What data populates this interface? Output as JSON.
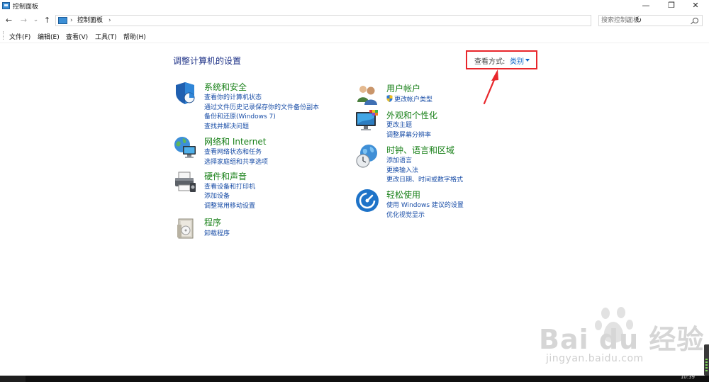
{
  "window": {
    "title": "控制面板",
    "controls": {
      "minimize": "—",
      "restore": "❐",
      "close": "✕"
    }
  },
  "nav": {
    "back": "←",
    "forward": "→",
    "recent": "⌄",
    "up": "↑",
    "refresh": "↻",
    "dropdown": "⌄"
  },
  "address": {
    "separator": "›",
    "path": "控制面板",
    "trailing_separator": "›"
  },
  "search": {
    "placeholder": "搜索控制面板",
    "value": ""
  },
  "menu": [
    "文件(F)",
    "编辑(E)",
    "查看(V)",
    "工具(T)",
    "帮助(H)"
  ],
  "main": {
    "title": "调整计算机的设置",
    "view_by": {
      "label": "查看方式:",
      "value": "类别"
    }
  },
  "categories_left": [
    {
      "title": "系统和安全",
      "icon": "shield-icon",
      "links": [
        "查看你的计算机状态",
        "通过文件历史记录保存你的文件备份副本",
        "备份和还原(Windows 7)",
        "查找并解决问题"
      ]
    },
    {
      "title": "网络和 Internet",
      "icon": "network-globe-icon",
      "links": [
        "查看网络状态和任务",
        "选择家庭组和共享选项"
      ]
    },
    {
      "title": "硬件和声音",
      "icon": "printer-icon",
      "links": [
        "查看设备和打印机",
        "添加设备",
        "调整常用移动设置"
      ]
    },
    {
      "title": "程序",
      "icon": "programs-icon",
      "links": [
        "卸载程序"
      ]
    }
  ],
  "categories_right": [
    {
      "title": "用户帐户",
      "icon": "users-icon",
      "links": [
        "更改帐户类型"
      ]
    },
    {
      "title": "外观和个性化",
      "icon": "monitor-palette-icon",
      "links": [
        "更改主题",
        "调整屏幕分辨率"
      ]
    },
    {
      "title": "时钟、语言和区域",
      "icon": "clock-globe-icon",
      "links": [
        "添加语言",
        "更换输入法",
        "更改日期、时间或数字格式"
      ]
    },
    {
      "title": "轻松使用",
      "icon": "accessibility-icon",
      "links": [
        "使用 Windows 建议的设置",
        "优化视觉显示"
      ]
    }
  ],
  "watermark": {
    "logo": "Bai  du 经验",
    "url": "jingyan.baidu.com"
  },
  "taskbar": {
    "time": "10:39"
  },
  "colors": {
    "link": "#1a4ea7",
    "category_title": "#198119",
    "highlight_box": "#e8262b",
    "heading": "#1e3287"
  }
}
